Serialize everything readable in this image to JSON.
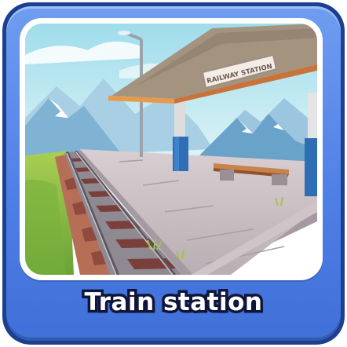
{
  "card": {
    "title": "Train station",
    "sign_text": "RAILWAY STATION"
  },
  "colors": {
    "frame_dark": "#1d3f8f",
    "frame_blue": "#4f80e6",
    "title_fill": "#ffffff",
    "title_stroke": "#10163a",
    "sky": "#cfeef2",
    "roof": "#e89a4a",
    "pillar": "#2f6db5"
  }
}
